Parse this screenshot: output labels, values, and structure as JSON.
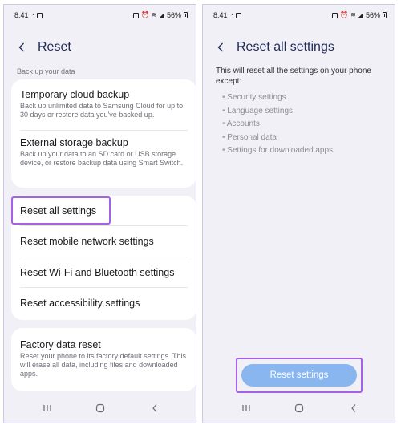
{
  "status_bar": {
    "time": "8:41",
    "battery": "56%"
  },
  "left_screen": {
    "title": "Reset",
    "section_label": "Back up your data",
    "backup_items": [
      {
        "title": "Temporary cloud backup",
        "description": "Back up unlimited data to Samsung Cloud for up to 30 days or restore data you've backed up."
      },
      {
        "title": "External storage backup",
        "description": "Back up your data to an SD card or USB storage device, or restore backup data using Smart Switch."
      }
    ],
    "reset_items": [
      {
        "title": "Reset all settings"
      },
      {
        "title": "Reset mobile network settings"
      },
      {
        "title": "Reset Wi-Fi and Bluetooth settings"
      },
      {
        "title": "Reset accessibility settings"
      }
    ],
    "factory_reset": {
      "title": "Factory data reset",
      "description": "Reset your phone to its factory default settings. This will erase all data, including files and downloaded apps."
    }
  },
  "right_screen": {
    "title": "Reset all settings",
    "intro": "This will reset all the settings on your phone except:",
    "exceptions": [
      "Security settings",
      "Language settings",
      "Accounts",
      "Personal data",
      "Settings for downloaded apps"
    ],
    "button_label": "Reset settings"
  },
  "colors": {
    "highlight": "#a660e6",
    "button": "#8ab6f0",
    "title": "#1f2a56",
    "background": "#f1f0f6"
  },
  "icons": [
    "whatsapp-icon",
    "gallery-icon",
    "lock-icon",
    "alarm-icon",
    "wifi-icon",
    "signal-icon",
    "battery-icon",
    "back-arrow-icon",
    "recent-apps-icon",
    "home-icon",
    "back-nav-icon"
  ]
}
